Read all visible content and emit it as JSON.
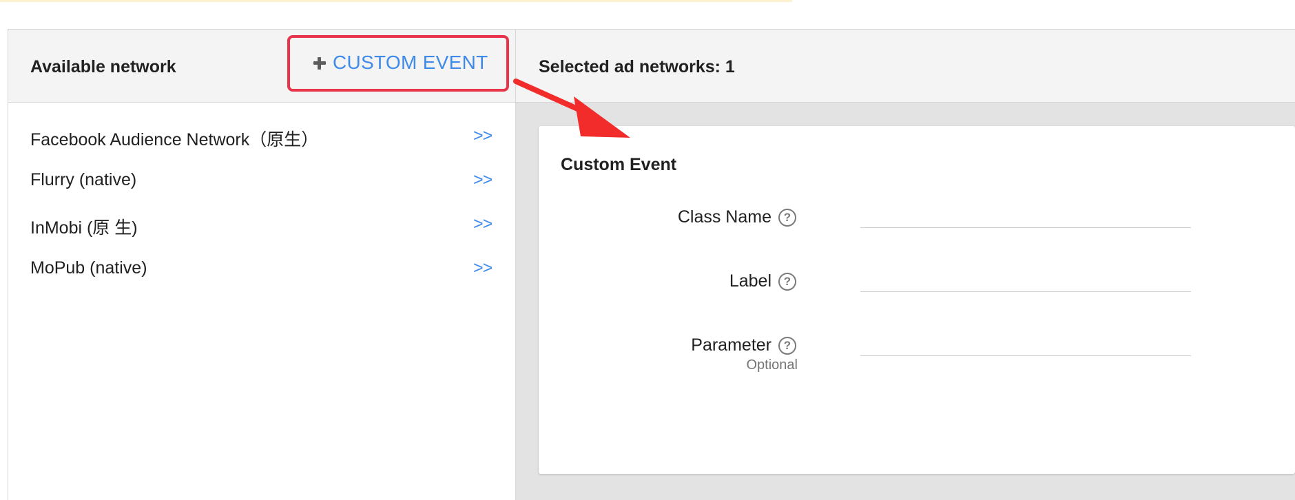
{
  "left_panel": {
    "title": "Available network",
    "custom_event_button": {
      "label": "CUSTOM EVENT",
      "icon": "plus-icon"
    },
    "networks": [
      {
        "name": "Facebook Audience Network（原生）",
        "action": ">>"
      },
      {
        "name": "Flurry (native)",
        "action": ">>"
      },
      {
        "name": "InMobi (原 生)",
        "action": ">>"
      },
      {
        "name": "MoPub (native)",
        "action": ">>"
      }
    ]
  },
  "right_panel": {
    "selected_label": "Selected ad networks: 1",
    "card": {
      "title": "Custom Event",
      "fields": [
        {
          "label": "Class Name",
          "help_icon": "?",
          "value": "",
          "sublabel": ""
        },
        {
          "label": "Label",
          "help_icon": "?",
          "value": "",
          "sublabel": ""
        },
        {
          "label": "Parameter",
          "help_icon": "?",
          "value": "",
          "sublabel": "Optional"
        }
      ]
    }
  },
  "colors": {
    "accent_blue": "#3f8ae8",
    "highlight_red": "#e8344a",
    "header_bg": "#f4f4f4",
    "panel_bg": "#e3e3e3"
  }
}
